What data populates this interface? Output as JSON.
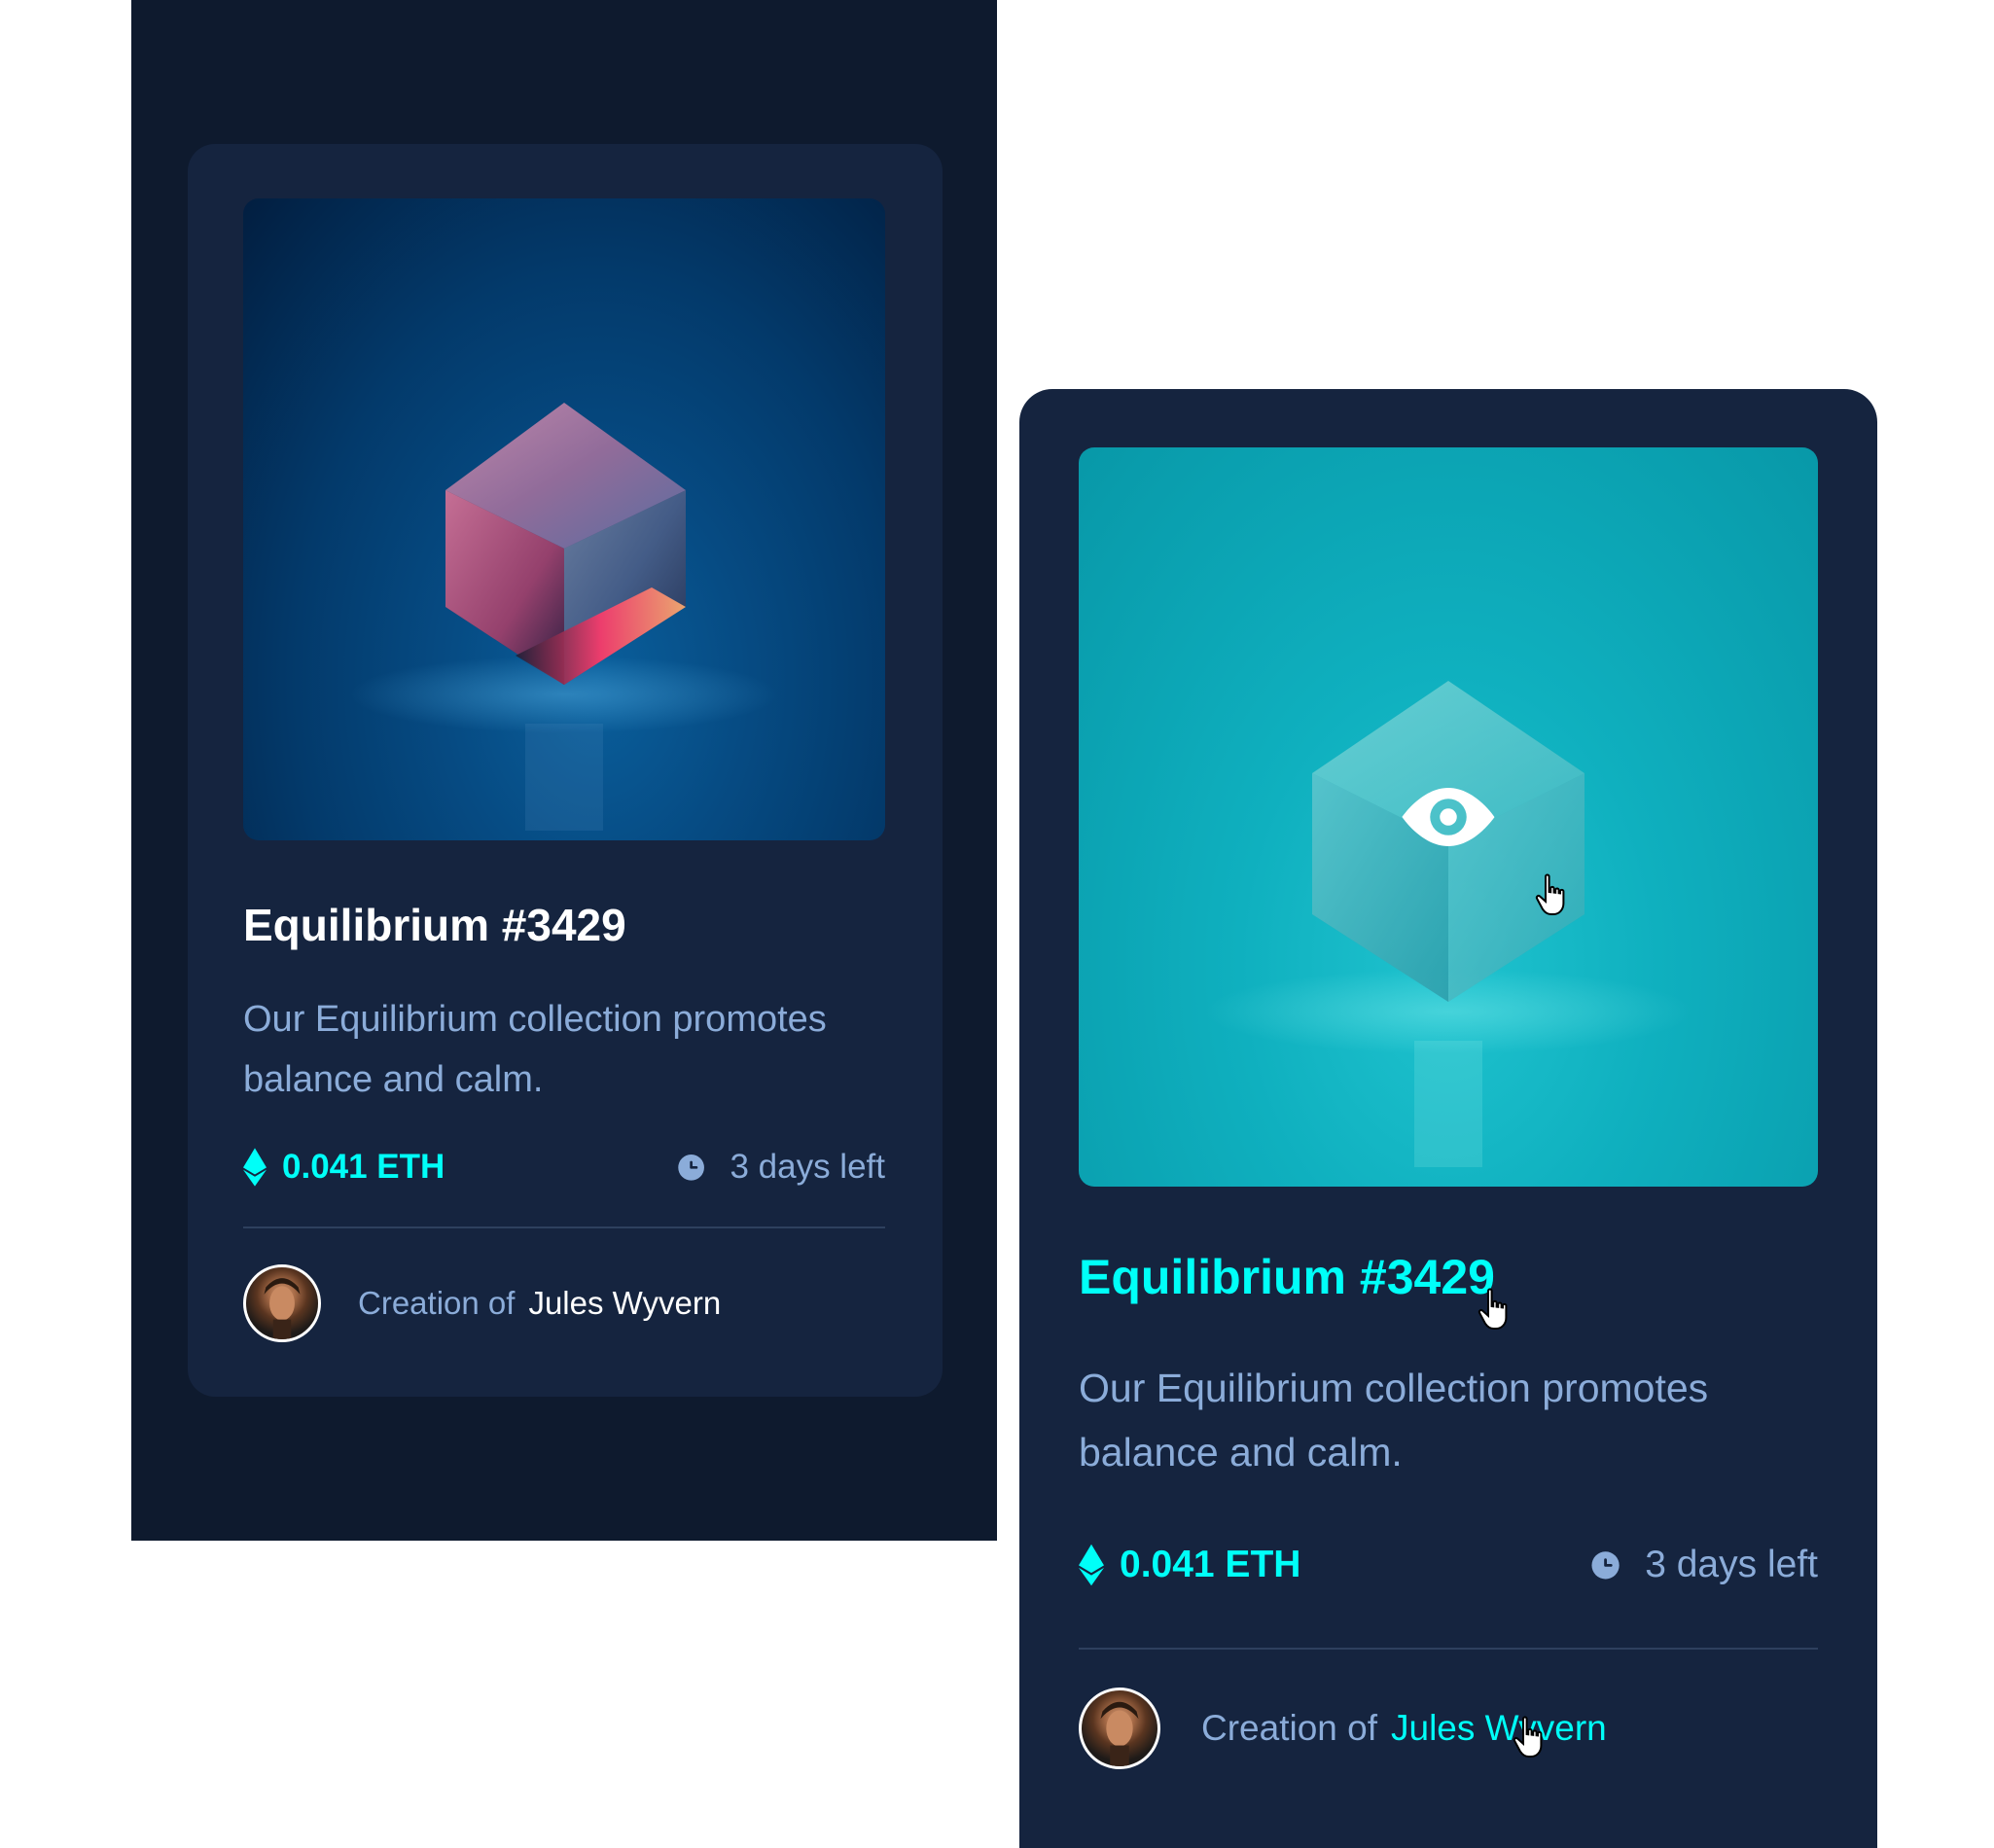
{
  "cards": [
    {
      "state": "default",
      "title": "Equilibrium #3429",
      "description": "Our Equilibrium collection promotes balance and calm.",
      "price": "0.041 ETH",
      "time_left": "3 days left",
      "creator_prefix": "Creation of",
      "creator_name": "Jules Wyvern"
    },
    {
      "state": "hover",
      "title": "Equilibrium #3429",
      "description": "Our Equilibrium collection promotes balance and calm.",
      "price": "0.041 ETH",
      "time_left": "3 days left",
      "creator_prefix": "Creation of",
      "creator_name": "Jules Wyvern"
    }
  ],
  "icons": {
    "price": "ethereum-icon",
    "time": "clock-icon",
    "overlay": "eye-icon",
    "cursor": "hand-pointer-icon"
  },
  "colors": {
    "page_background": "#0e1a2e",
    "card_background": "#15243f",
    "accent_cyan": "#00fff8",
    "soft_blue_text": "#8bacd9",
    "white": "#ffffff",
    "divider": "#2e405e"
  }
}
